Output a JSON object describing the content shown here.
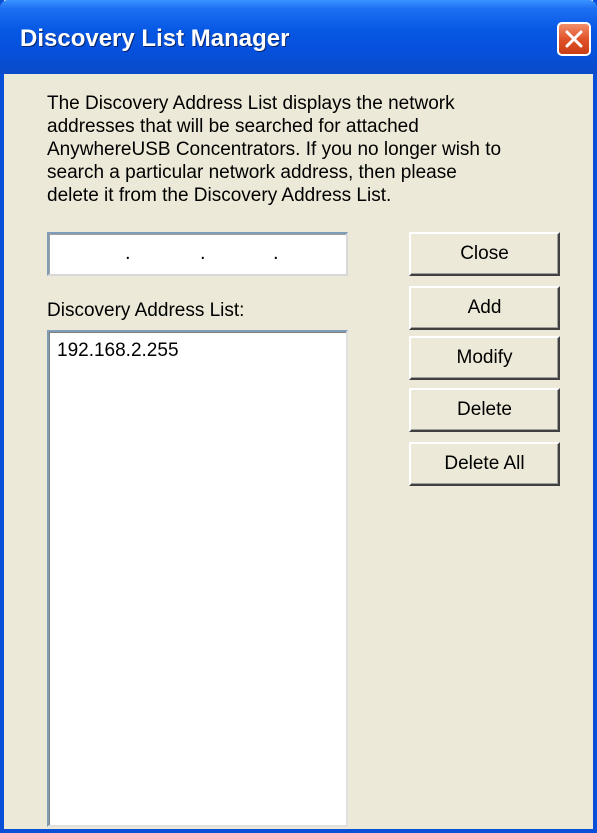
{
  "window": {
    "title": "Discovery List Manager"
  },
  "description": "The Discovery Address List displays the network\naddresses that will be searched for attached\nAnywhereUSB Concentrators. If you no longer wish to\nsearch a particular network address, then please\ndelete it from the Discovery Address List.",
  "ip_input": {
    "separators": [
      ".",
      ".",
      "."
    ]
  },
  "list": {
    "label": "Discovery Address List:",
    "items": [
      "192.168.2.255"
    ]
  },
  "buttons": {
    "close": "Close",
    "add": "Add",
    "modify": "Modify",
    "delete": "Delete",
    "delete_all": "Delete All"
  },
  "colors": {
    "title_bar": "#0a58e0",
    "dialog_bg": "#ece9d8",
    "close_button": "#e1532a"
  },
  "icons": {
    "close": "close-x-icon"
  }
}
